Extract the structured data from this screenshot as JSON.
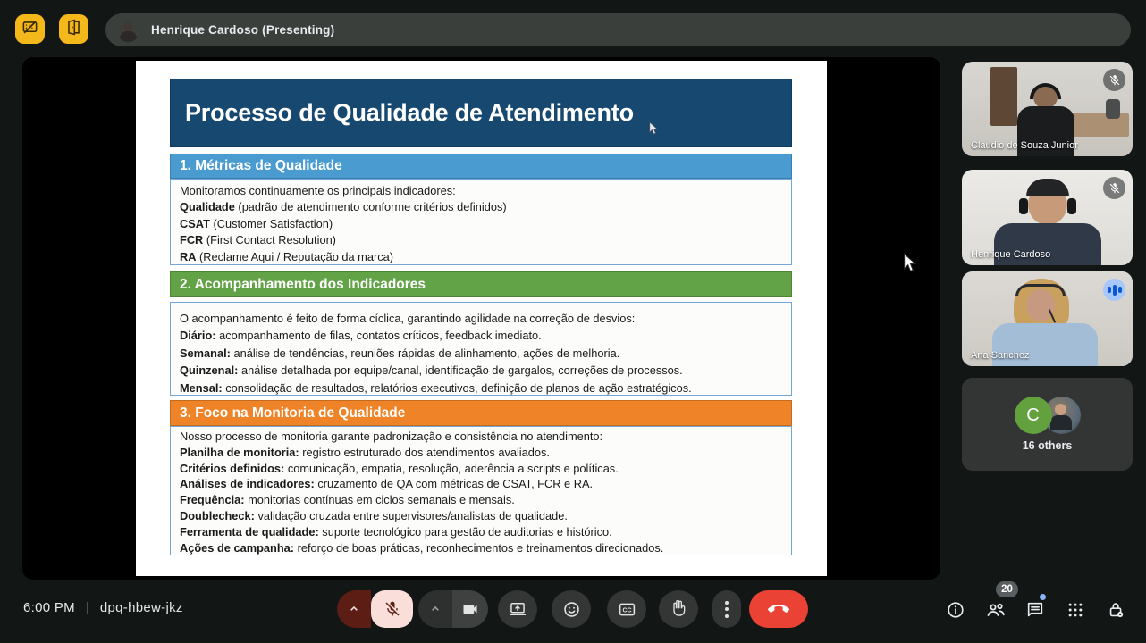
{
  "top_bar": {
    "presenter_label": "Henrique Cardoso (Presenting)",
    "warning_buttons": [
      {
        "icon": "keyboard-off-icon"
      },
      {
        "icon": "door-open-icon"
      }
    ]
  },
  "slide": {
    "title": "Processo de Qualidade de Atendimento",
    "title_bg": "#17486f",
    "sections": [
      {
        "header": "1. Métricas de Qualidade",
        "color": "#4a9bd0",
        "lines": [
          {
            "bold": "",
            "rest": "Monitoramos continuamente os principais indicadores:"
          },
          {
            "bold": "Qualidade",
            "rest": " (padrão de atendimento conforme critérios definidos)"
          },
          {
            "bold": "CSAT",
            "rest": " (Customer Satisfaction)"
          },
          {
            "bold": "FCR",
            "rest": " (First Contact Resolution)"
          },
          {
            "bold": "RA",
            "rest": " (Reclame Aqui / Reputação da marca)"
          }
        ]
      },
      {
        "header": "2. Acompanhamento dos Indicadores",
        "color": "#61a346",
        "lines": [
          {
            "bold": "",
            "rest": "O acompanhamento é feito de forma cíclica, garantindo agilidade na correção de desvios:"
          },
          {
            "bold": "Diário:",
            "rest": " acompanhamento de filas, contatos críticos, feedback imediato."
          },
          {
            "bold": "Semanal:",
            "rest": " análise de tendências, reuniões rápidas de alinhamento, ações de melhoria."
          },
          {
            "bold": "Quinzenal:",
            "rest": " análise detalhada por equipe/canal, identificação de gargalos, correções de processos."
          },
          {
            "bold": "Mensal:",
            "rest": " consolidação de resultados, relatórios executivos, definição de planos de ação estratégicos."
          }
        ]
      },
      {
        "header": "3. Foco na Monitoria de Qualidade",
        "color": "#ef8327",
        "lines": [
          {
            "bold": "",
            "rest": "Nosso processo de monitoria garante padronização e consistência no atendimento:"
          },
          {
            "bold": "Planilha de monitoria:",
            "rest": " registro estruturado dos atendimentos avaliados."
          },
          {
            "bold": "Critérios definidos:",
            "rest": " comunicação, empatia, resolução, aderência a scripts e políticas."
          },
          {
            "bold": "Análises de indicadores:",
            "rest": " cruzamento de QA com métricas de CSAT, FCR e RA."
          },
          {
            "bold": "Frequência:",
            "rest": " monitorias contínuas em ciclos semanais e mensais."
          },
          {
            "bold": "Doublecheck:",
            "rest": " validação cruzada entre supervisores/analistas de qualidade."
          },
          {
            "bold": "Ferramenta de qualidade:",
            "rest": " suporte tecnológico para gestão de auditorias e histórico."
          },
          {
            "bold": "Ações de campanha:",
            "rest": " reforço de boas práticas, reconhecimentos e treinamentos direcionados."
          }
        ]
      }
    ]
  },
  "participants": [
    {
      "name": "Claudio de Souza Junior",
      "muted": true
    },
    {
      "name": "Henrique Cardoso",
      "muted": true
    },
    {
      "name": "Ana Sanchez",
      "speaking": true
    },
    {
      "label": "16 others",
      "avatar_letter": "C"
    }
  ],
  "bottom_bar": {
    "time": "6:00 PM",
    "separator": "|",
    "meeting_code": "dpq-hbew-jkz",
    "controls": [
      {
        "name": "mic-toggle",
        "state": "muted",
        "icon": "mic-off-icon"
      },
      {
        "name": "camera-toggle",
        "state": "on",
        "icon": "camera-icon"
      },
      {
        "name": "present-screen",
        "icon": "present-screen-icon"
      },
      {
        "name": "reactions",
        "icon": "emoji-icon"
      },
      {
        "name": "captions",
        "icon": "cc-icon",
        "glyph": "CC"
      },
      {
        "name": "raise-hand",
        "icon": "hand-icon"
      },
      {
        "name": "more-options",
        "icon": "three-dots-icon"
      },
      {
        "name": "leave-call",
        "icon": "phone-down-icon"
      }
    ],
    "right_icons": [
      {
        "name": "meeting-details",
        "icon": "info-icon"
      },
      {
        "name": "people",
        "icon": "people-icon",
        "badge": "20"
      },
      {
        "name": "chat",
        "icon": "chat-icon",
        "unread_dot": true
      },
      {
        "name": "activities",
        "icon": "apps-grid-icon"
      },
      {
        "name": "host-controls",
        "icon": "lock-icon"
      }
    ],
    "people_count": "20"
  },
  "colors": {
    "accent_yellow": "#f5b81a",
    "end_call_red": "#ea4335",
    "speaking_blue": "#9ec1fb",
    "audio_badge_blue": "#a8c7fa",
    "mic_muted_pink": "#f9ded9",
    "mic_muted_dark_red": "#5b1d14",
    "slide_title_navy": "#17486f",
    "section1_blue": "#4a9bd0",
    "section2_green": "#61a346",
    "section3_orange": "#ef8327"
  }
}
